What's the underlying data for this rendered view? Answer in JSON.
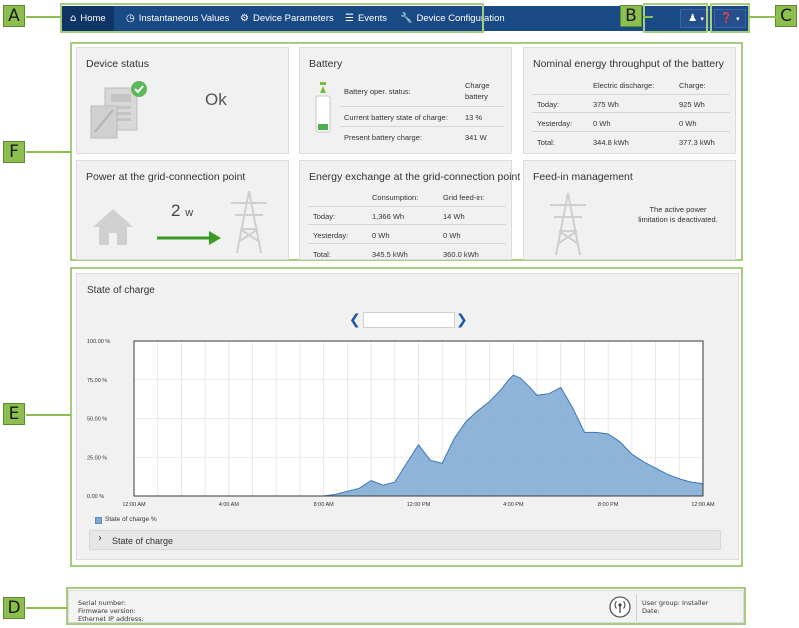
{
  "callouts": [
    "A",
    "B",
    "C",
    "D",
    "E",
    "F"
  ],
  "nav": {
    "home": "Home",
    "instantaneous": "Instantaneous Values",
    "device_parameters": "Device Parameters",
    "events": "Events",
    "device_configuration": "Device Configuration",
    "user_menu": "user-icon",
    "help_menu": "help-icon"
  },
  "device_status": {
    "title": "Device status",
    "value": "Ok"
  },
  "battery": {
    "title": "Battery",
    "rows": [
      {
        "label": "Battery oper. status:",
        "value1": "Charge",
        "value2": "battery"
      },
      {
        "label": "Current battery state of charge:",
        "value1": "13 %"
      },
      {
        "label": "Present battery charge:",
        "value1": "341 W"
      }
    ]
  },
  "nominal": {
    "title": "Nominal energy throughput of the battery",
    "headers": [
      "Electric discharge:",
      "Charge:"
    ],
    "rows": [
      {
        "label": "Today:",
        "a": "375 Wh",
        "b": "925 Wh"
      },
      {
        "label": "Yesterday:",
        "a": "0 Wh",
        "b": "0 Wh"
      },
      {
        "label": "Total:",
        "a": "344.8 kWh",
        "b": "377.3 kWh"
      }
    ]
  },
  "power_grid": {
    "title": "Power at the grid-connection point",
    "value": "2",
    "unit": "w"
  },
  "energy_exchange": {
    "title": "Energy exchange at the grid-connection point",
    "headers": [
      "Consumption:",
      "Grid feed-in:"
    ],
    "rows": [
      {
        "label": "Today:",
        "a": "1,366 Wh",
        "b": "14 Wh"
      },
      {
        "label": "Yesterday:",
        "a": "0 Wh",
        "b": "0 Wh"
      },
      {
        "label": "Total:",
        "a": "345.5 kWh",
        "b": "360.0 kWh"
      }
    ]
  },
  "feed_in": {
    "title": "Feed-in management",
    "line1": "The active power",
    "line2": "limitation is deactivated."
  },
  "soc": {
    "title": "State of charge",
    "date_value": "",
    "legend": "State of charge %",
    "expander": "State of charge"
  },
  "footer": {
    "serial": "Serial number:",
    "firmware": "Firmware version:",
    "ethernet": "Ethernet IP address:",
    "user_group": "User group: Installer",
    "date": "Date:"
  },
  "chart_data": {
    "type": "area",
    "title": "State of charge",
    "ylabel": "",
    "xlabel": "",
    "yticks": [
      "0.00 %",
      "25.00 %",
      "50.00 %",
      "75.00 %",
      "100.00 %"
    ],
    "ylim": [
      0,
      100
    ],
    "xticks": [
      "12:00 AM",
      "4:00 AM",
      "8:00 AM",
      "12:00 PM",
      "4:00 PM",
      "8:00 PM",
      "12:00 AM"
    ],
    "xlim": [
      0,
      24
    ],
    "grid": true,
    "legend_position": "bottom-left",
    "series": [
      {
        "name": "State of charge %",
        "color": "#7aa8d2",
        "x": [
          0,
          8.0,
          8.5,
          9.0,
          9.5,
          10.0,
          10.5,
          11.0,
          11.5,
          12.0,
          12.5,
          13.0,
          13.5,
          14.0,
          14.5,
          15.0,
          15.5,
          15.8,
          16.0,
          16.3,
          16.7,
          17.0,
          17.5,
          18.0,
          18.5,
          19.0,
          19.5,
          20.0,
          20.5,
          21.0,
          21.5,
          22.0,
          22.5,
          23.0,
          23.5,
          24.0
        ],
        "y": [
          0,
          0,
          1,
          3,
          5,
          10,
          7,
          9,
          21,
          33,
          23,
          21,
          37,
          48,
          55,
          61,
          69,
          75,
          78,
          76,
          70,
          65,
          66,
          70,
          57,
          41,
          41,
          40,
          35,
          27,
          22,
          18,
          14,
          11,
          9,
          8
        ]
      }
    ]
  }
}
